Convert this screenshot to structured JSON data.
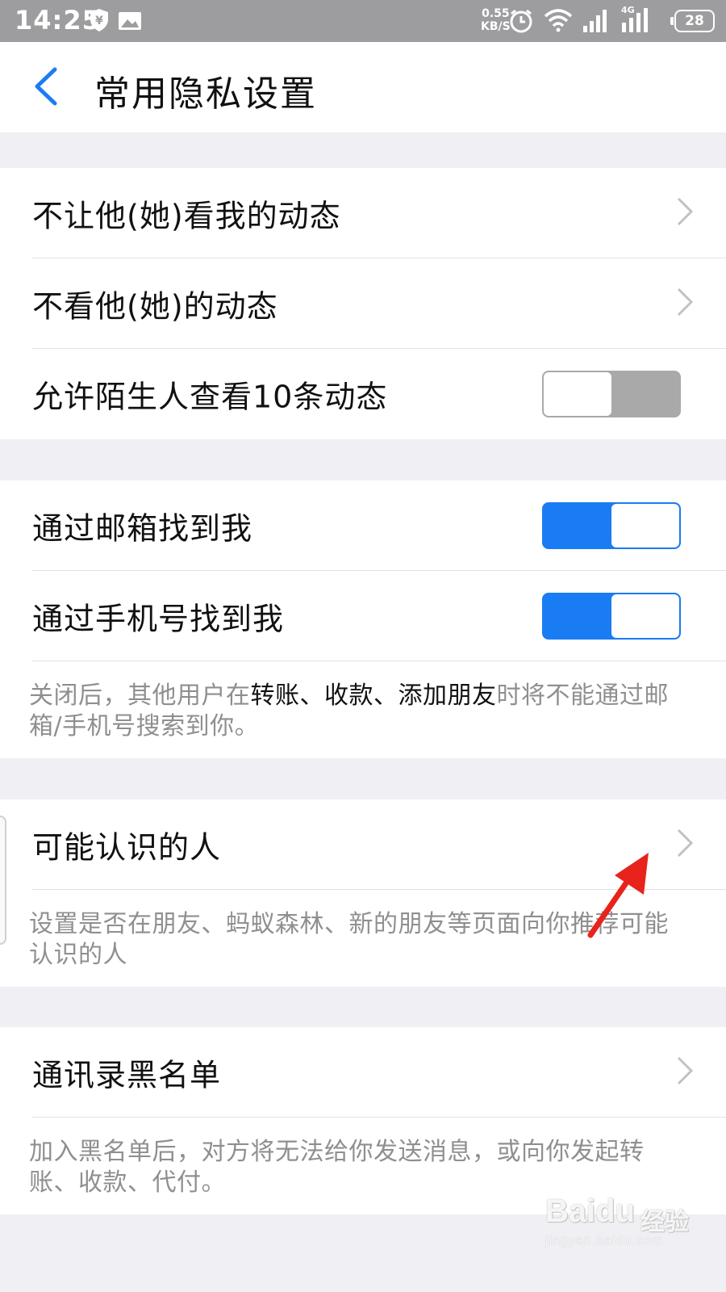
{
  "status_bar": {
    "time": "14:25",
    "speed_value": "0.55",
    "speed_unit": "KB/S",
    "network_type": "4G",
    "battery": "28",
    "icons": [
      "yuan-shield-icon",
      "image-icon",
      "alarm-icon",
      "wifi-icon",
      "signal-icon",
      "signal-4g-icon",
      "battery-icon"
    ]
  },
  "nav": {
    "title": "常用隐私设置",
    "back_icon": "chevron-left-icon"
  },
  "section1": {
    "items": [
      {
        "label": "不让他(她)看我的动态",
        "type": "link"
      },
      {
        "label": "不看他(她)的动态",
        "type": "link"
      },
      {
        "label": "允许陌生人查看10条动态",
        "type": "toggle",
        "enabled": false
      }
    ]
  },
  "section2": {
    "items": [
      {
        "label": "通过邮箱找到我",
        "type": "toggle",
        "enabled": true
      },
      {
        "label": "通过手机号找到我",
        "type": "toggle",
        "enabled": true
      }
    ],
    "note": {
      "prefix": "关闭后，其他用户在",
      "highlight": "转账、收款、添加朋友",
      "suffix": "时将不能通过邮箱/手机号搜索到你。"
    }
  },
  "section3": {
    "item_label": "可能认识的人",
    "note": "设置是否在朋友、蚂蚁森林、新的朋友等页面向你推荐可能认识的人"
  },
  "section4": {
    "item_label": "通讯录黑名单",
    "note": "加入黑名单后，对方将无法给你发送消息，或向你发起转账、收款、代付。"
  },
  "watermark": {
    "logo": "Baidu",
    "brand": "经验",
    "url": "jingyan.baidu.com"
  },
  "colors": {
    "accent": "#1a7cf2",
    "toggle_off": "#a9a9a9",
    "arrow": "#e8231c",
    "page_bg": "#efeff4",
    "status_bar_bg": "#9d9d9f"
  }
}
